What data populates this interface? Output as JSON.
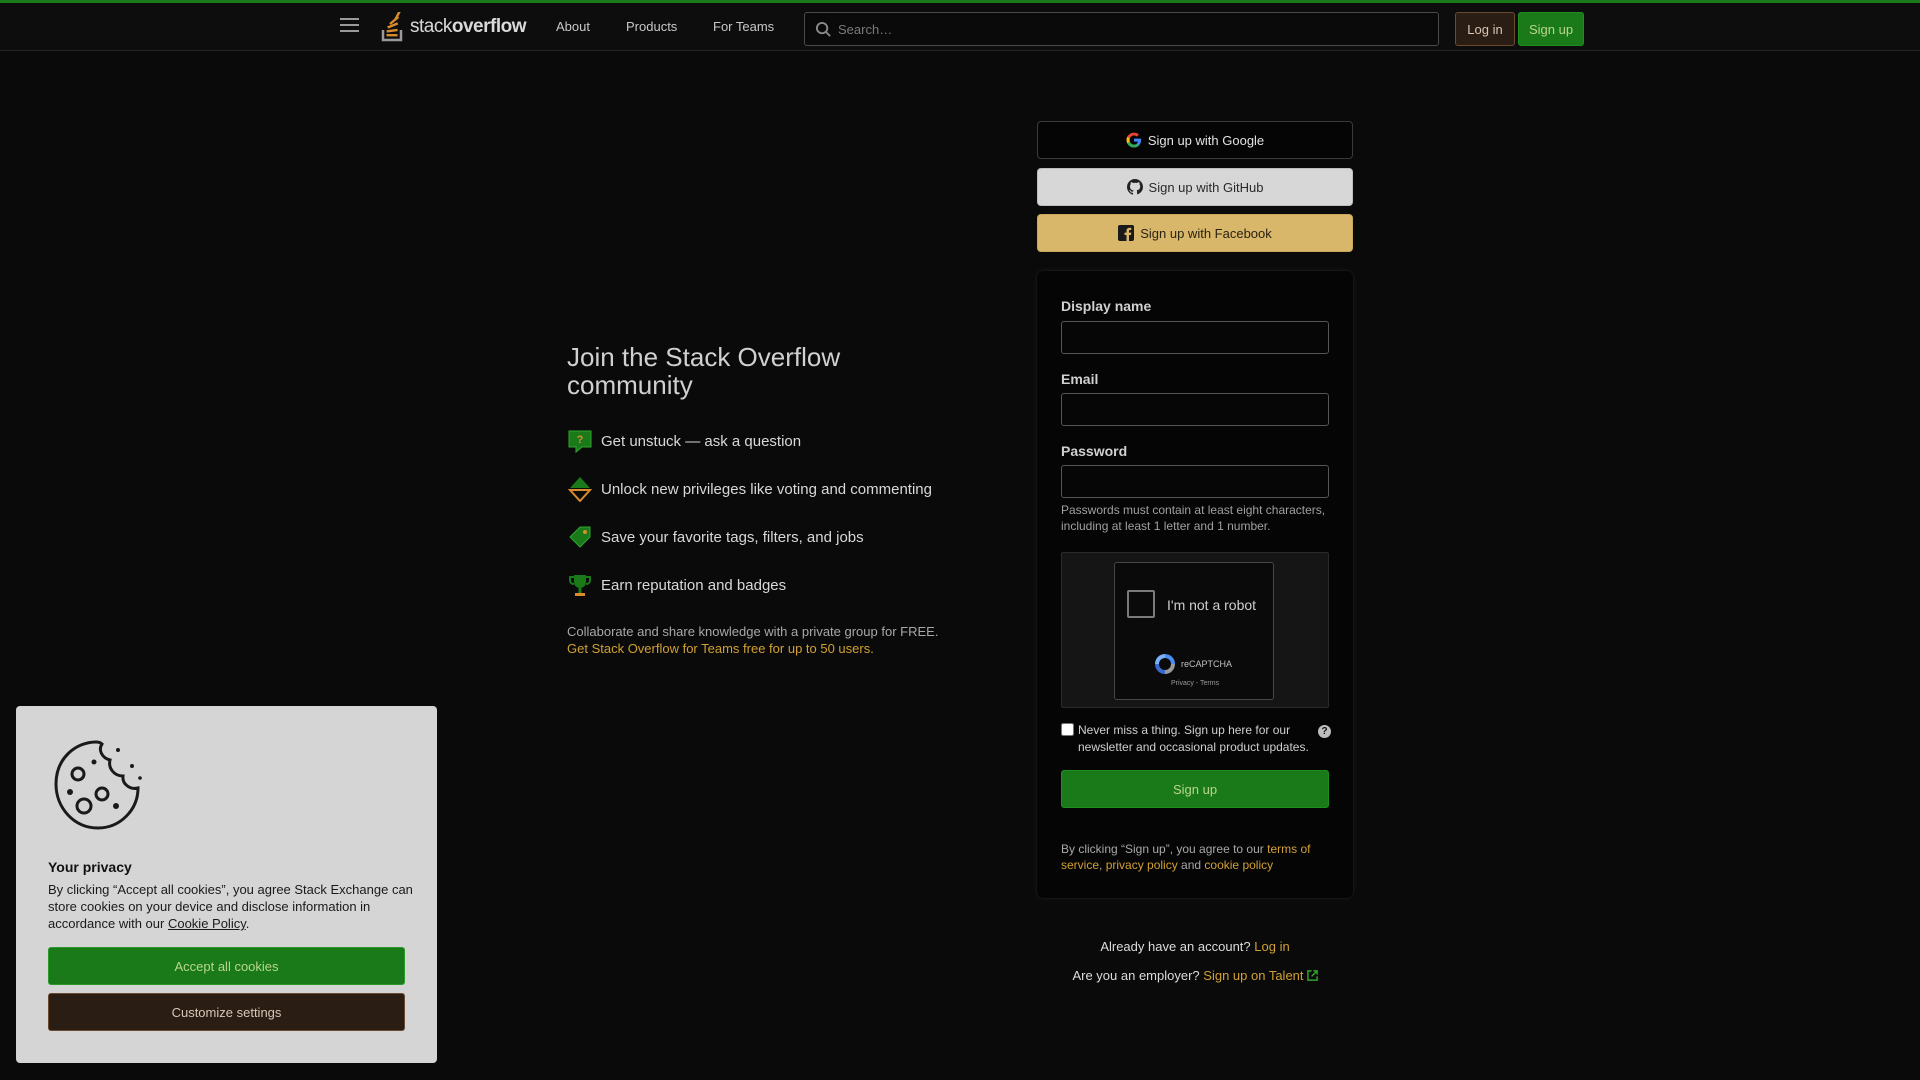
{
  "header": {
    "logo_text_prefix": "stack",
    "logo_text_suffix": "overflow",
    "nav": {
      "about": "About",
      "products": "Products",
      "for_teams": "For Teams"
    },
    "search_placeholder": "Search…",
    "login_label": "Log in",
    "signup_label": "Sign up"
  },
  "promo": {
    "title": "Join the Stack Overflow community",
    "features": [
      {
        "icon": "question-bubble-icon",
        "text": "Get unstuck — ask a question"
      },
      {
        "icon": "vote-arrows-icon",
        "text": "Unlock new privileges like voting and commenting"
      },
      {
        "icon": "tag-icon",
        "text": "Save your favorite tags, filters, and jobs"
      },
      {
        "icon": "trophy-icon",
        "text": "Earn reputation and badges"
      }
    ],
    "collab_text": "Collaborate and share knowledge with a private group for FREE.",
    "collab_link": "Get Stack Overflow for Teams free for up to 50 users."
  },
  "social": {
    "google": "Sign up with Google",
    "github": "Sign up with GitHub",
    "facebook": "Sign up with Facebook"
  },
  "form": {
    "display_name_label": "Display name",
    "email_label": "Email",
    "password_label": "Password",
    "password_hint": "Passwords must contain at least eight characters, including at least 1 letter and 1 number.",
    "captcha_label": "I'm not a robot",
    "captcha_brand": "reCAPTCHA",
    "captcha_links": "Privacy - Terms",
    "newsletter_text": "Never miss a thing. Sign up here for our newsletter and occasional product updates.",
    "help_glyph": "?",
    "submit_label": "Sign up",
    "terms_prefix": "By clicking “Sign up”, you agree to our ",
    "terms_link": "terms of service",
    "terms_sep": ", ",
    "privacy_link": "privacy policy",
    "terms_and": " and ",
    "cookie_link": "cookie policy"
  },
  "footer_links": {
    "have_account": "Already have an account?",
    "login_link": "Log in",
    "employer": "Are you an employer?",
    "talent_link": "Sign up on Talent"
  },
  "cookie_panel": {
    "title": "Your privacy",
    "body": "By clicking “Accept all cookies”, you agree Stack Exchange can store cookies on your device and disclose information in accordance with our ",
    "policy_link": "Cookie Policy",
    "body_end": ".",
    "accept_label": "Accept all cookies",
    "customize_label": "Customize settings"
  },
  "colors": {
    "accent_green": "#1a7a1a",
    "link_orange": "#d1a033",
    "background": "#0a0a0a"
  }
}
